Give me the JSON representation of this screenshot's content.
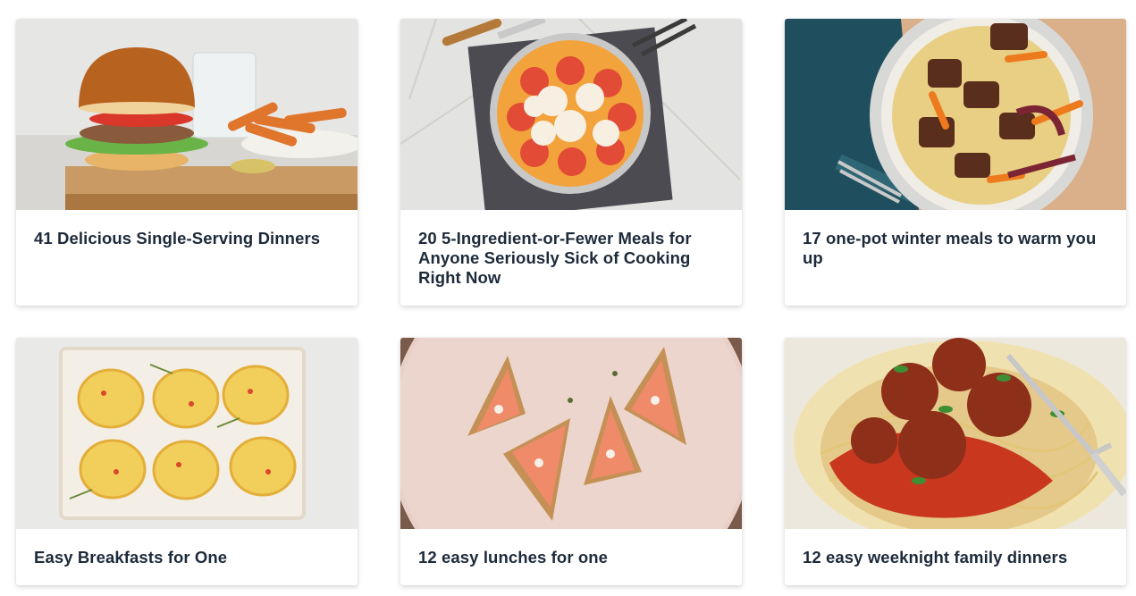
{
  "cards": [
    {
      "title": "41 Delicious Single-Serving Dinners",
      "image": "burger-with-sweet-potato-fries-photo"
    },
    {
      "title": "20 5-Ingredient-or-Fewer Meals for Anyone Seriously Sick of Cooking Right Now",
      "image": "tomato-mozzarella-skillet-photo"
    },
    {
      "title": "17 one-pot winter meals to warm you up",
      "image": "beef-noodle-stew-bowl-photo"
    },
    {
      "title": "Easy Breakfasts for One",
      "image": "egg-muffins-tray-photo"
    },
    {
      "title": "12 easy lunches for one",
      "image": "smoked-salmon-toasts-plate-photo"
    },
    {
      "title": "12 easy weeknight family dinners",
      "image": "spaghetti-meatballs-plate-photo"
    }
  ]
}
